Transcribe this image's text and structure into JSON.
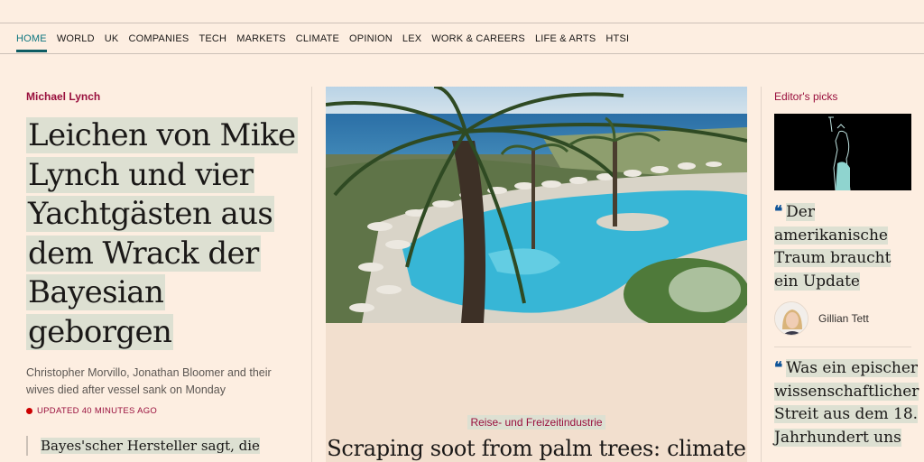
{
  "nav": {
    "items": [
      "HOME",
      "WORLD",
      "UK",
      "COMPANIES",
      "TECH",
      "MARKETS",
      "CLIMATE",
      "OPINION",
      "LEX",
      "WORK & CAREERS",
      "LIFE & ARTS",
      "HTSI"
    ],
    "active": "HOME"
  },
  "lead": {
    "kicker": "Michael Lynch",
    "headline": "Leichen von Mike Lynch und vier Yachtgästen aus dem Wrack der Bayesian geborgen",
    "standfirst": "Christopher Morvillo, Jonathan Bloomer and their wives died after vessel sank on Monday",
    "timestamp": "UPDATED 40 MINUTES AGO",
    "related": "Bayes'scher Hersteller sagt, die"
  },
  "feature": {
    "kicker": "Reise- und Freizeitindustrie",
    "title": "Scraping soot from palm trees: climate"
  },
  "editors_picks": {
    "label": "Editor's picks",
    "pick1": "Der amerikanische Traum braucht ein Update",
    "pick1_author": "Gillian Tett",
    "pick2": "Was ein epischer wissenschaftlicher Streit aus dem 18. Jahrhundert uns"
  },
  "colors": {
    "background": "#fdeee1",
    "accent_claret": "#990f3d",
    "accent_teal": "#0d7680",
    "highlight": "#dde0d2",
    "quote_blue": "#0f5499"
  }
}
